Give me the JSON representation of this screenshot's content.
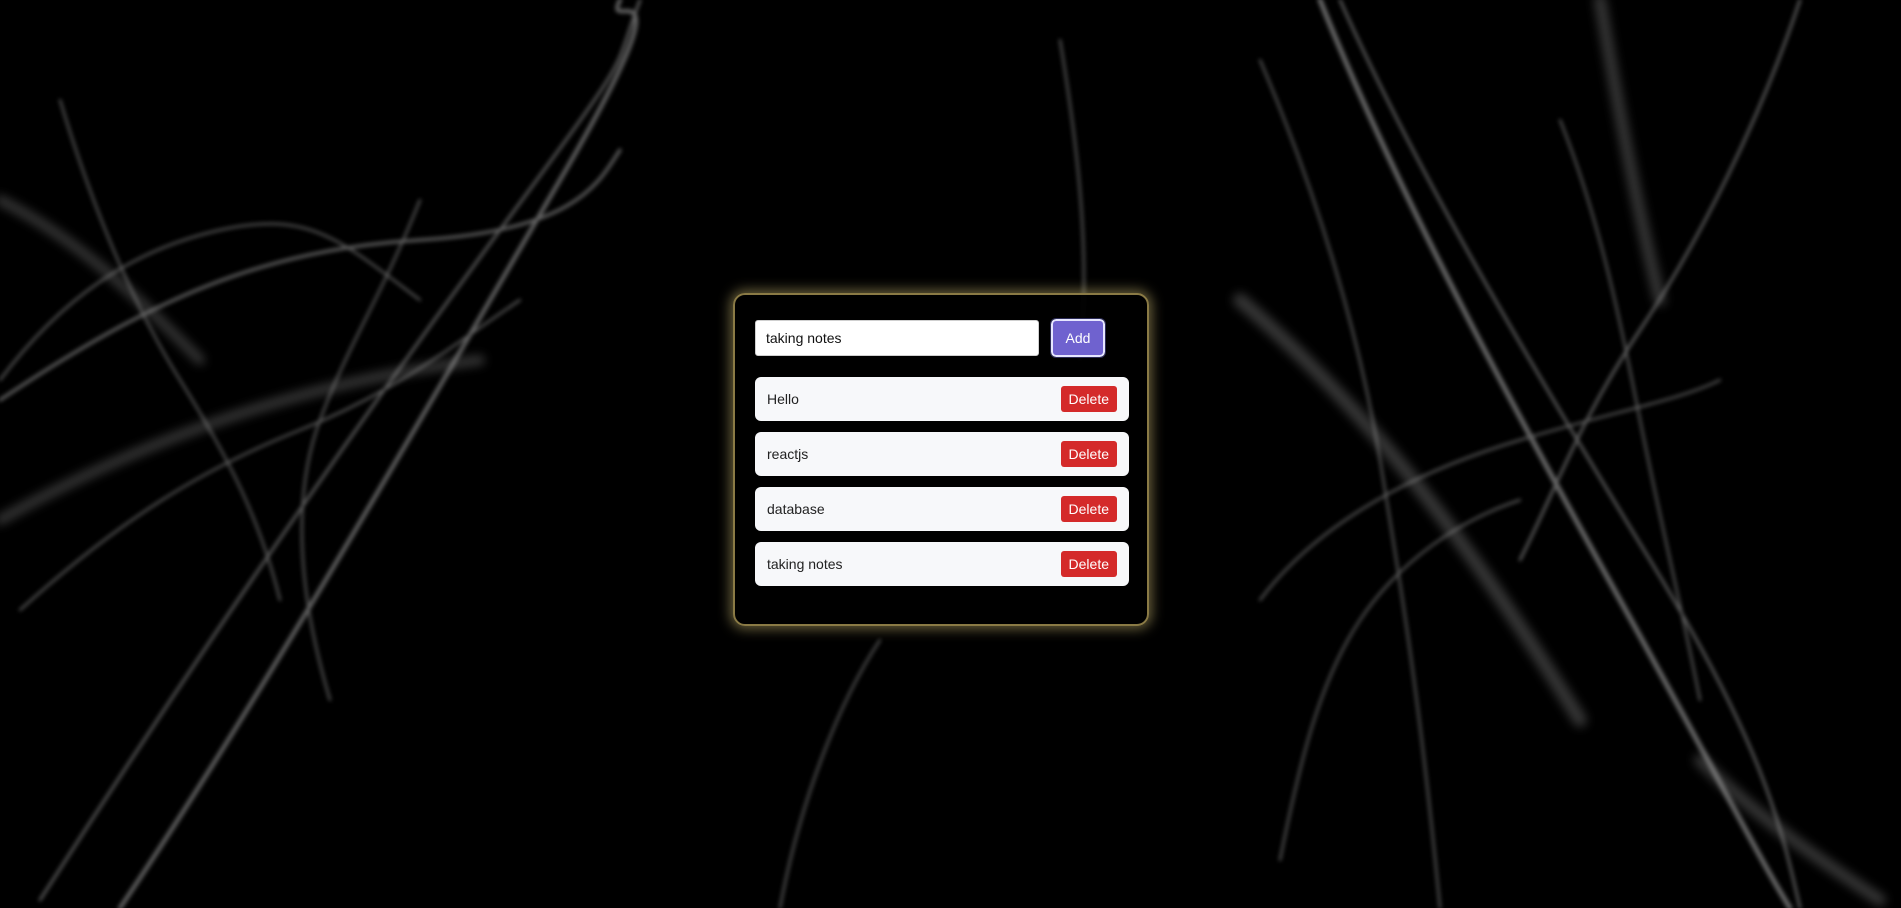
{
  "colors": {
    "background": "#000000",
    "card_glow": "#e6d282",
    "add_button": "#6f62cf",
    "delete_button": "#d42a2a",
    "note_background": "#f7f8fa"
  },
  "composer": {
    "input_value": "taking notes",
    "add_label": "Add"
  },
  "notes": [
    {
      "text": "Hello",
      "delete_label": "Delete"
    },
    {
      "text": "reactjs",
      "delete_label": "Delete"
    },
    {
      "text": "database",
      "delete_label": "Delete"
    },
    {
      "text": "taking notes",
      "delete_label": "Delete"
    }
  ]
}
